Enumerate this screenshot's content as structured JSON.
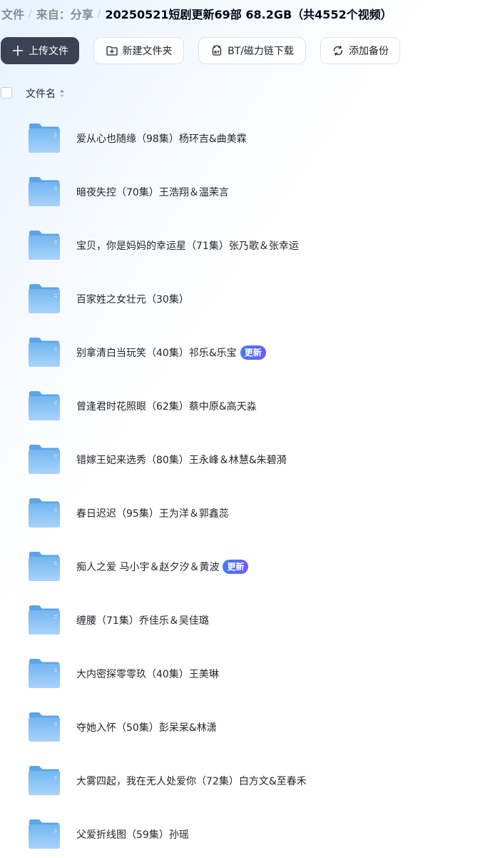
{
  "breadcrumb": {
    "root": "文件",
    "from": "来自：分享",
    "current": "20250521短剧更新69部 68.2GB（共4552个视频）",
    "separator": "/"
  },
  "toolbar": {
    "upload_label": "上传文件",
    "new_folder_label": "新建文件夹",
    "bt_label": "BT/磁力链下载",
    "backup_label": "添加备份"
  },
  "list_header": {
    "name_column": "文件名"
  },
  "colors": {
    "primary_button": "#3c4156",
    "folder_blue": "#6ab0ee",
    "badge_start": "#3f7bff",
    "badge_end": "#6c5cf6"
  },
  "files": [
    {
      "name": "爱从心也随缘（98集）杨环吉&曲美霖",
      "badge": ""
    },
    {
      "name": "暗夜失控（70集）王浩翔＆温茉言",
      "badge": ""
    },
    {
      "name": "宝贝，你是妈妈的幸运星（71集）张乃歌＆张幸运",
      "badge": ""
    },
    {
      "name": "百家姓之女壮元（30集）",
      "badge": ""
    },
    {
      "name": "别拿清白当玩笑（40集）祁乐&乐宝",
      "badge": "更新"
    },
    {
      "name": "曾逢君时花照眼（62集）蔡中原&高天淼",
      "badge": ""
    },
    {
      "name": "错嫁王妃来选秀（80集）王永峰＆林慧&朱碧漪",
      "badge": ""
    },
    {
      "name": "春日迟迟（95集）王为洋＆郭鑫蕊",
      "badge": ""
    },
    {
      "name": "痴人之爱 马小宇＆赵夕汐＆黄波",
      "badge": "更新"
    },
    {
      "name": "缠腰（71集）乔佳乐＆吴佳璐",
      "badge": ""
    },
    {
      "name": "大内密探零零玖（40集）王美琳",
      "badge": ""
    },
    {
      "name": "夺她入怀（50集）彭呆呆&林潇",
      "badge": ""
    },
    {
      "name": "大雾四起，我在无人处爱你（72集）白方文&至春禾",
      "badge": ""
    },
    {
      "name": "父爱折线图（59集）孙瑶",
      "badge": ""
    }
  ]
}
